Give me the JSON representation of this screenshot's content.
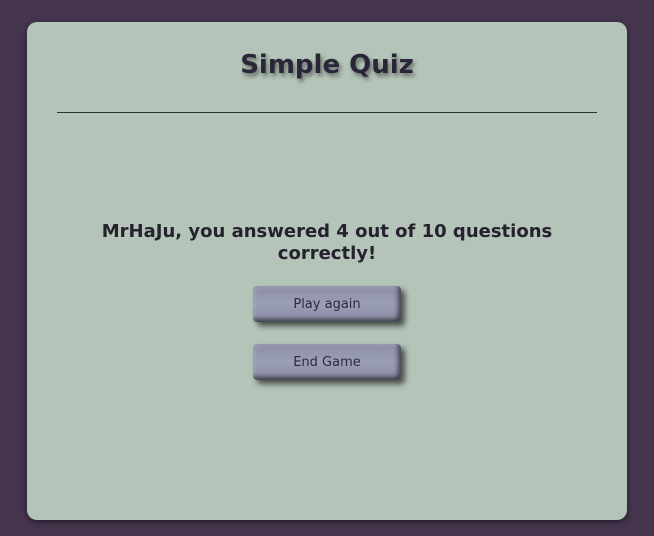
{
  "quiz": {
    "title": "Simple Quiz",
    "result_text": "MrHaJu, you answered 4 out of 10 questions correctly!",
    "play_again_label": "Play again",
    "end_game_label": "End Game"
  },
  "colors": {
    "background": "#45344d",
    "card": "#b4c4b8",
    "button": "#9b9eb7",
    "text": "#25222e"
  }
}
